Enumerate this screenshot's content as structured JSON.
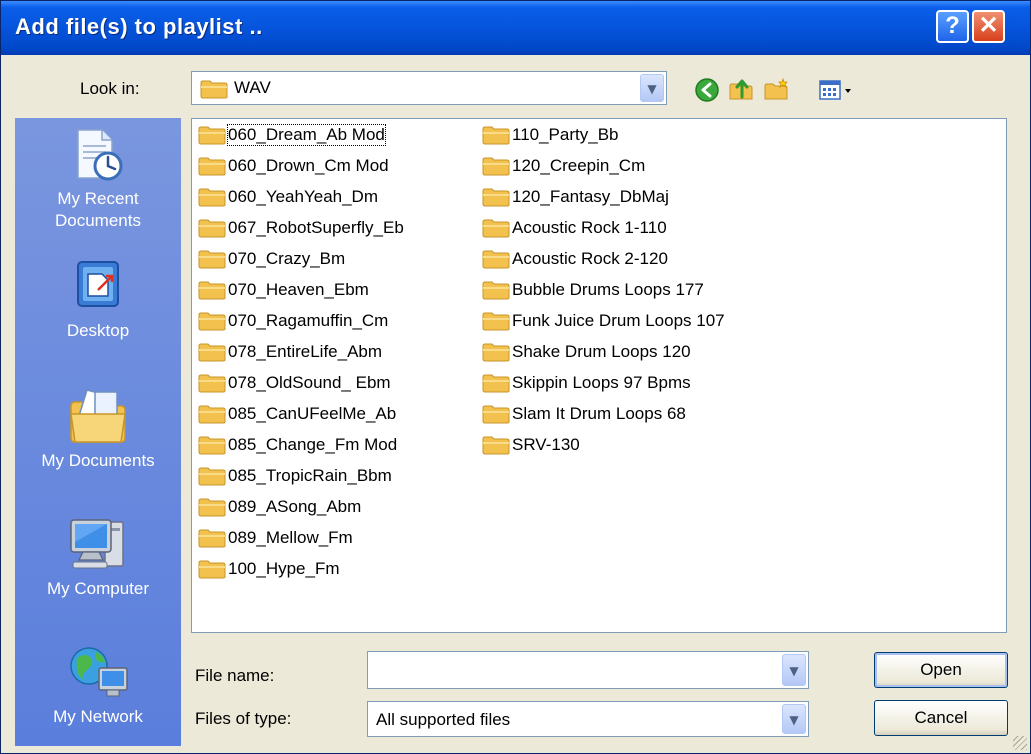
{
  "window": {
    "title": "Add file(s) to playlist ..",
    "help_label": "?",
    "close_label": "✕"
  },
  "toolbar": {
    "look_in_label": "Look in:",
    "current_folder": "WAV",
    "icons": [
      "back-icon",
      "up-folder-icon",
      "new-folder-icon",
      "view-menu-icon"
    ]
  },
  "places": [
    {
      "label_lines": [
        "My Recent",
        "Documents"
      ],
      "icon": "recent-documents-icon"
    },
    {
      "label_lines": [
        "Desktop"
      ],
      "icon": "desktop-icon"
    },
    {
      "label_lines": [
        "My Documents"
      ],
      "icon": "my-documents-icon"
    },
    {
      "label_lines": [
        "My Computer"
      ],
      "icon": "my-computer-icon"
    },
    {
      "label_lines": [
        "My Network"
      ],
      "icon": "my-network-icon"
    }
  ],
  "files": {
    "column1": [
      "060_Dream_Ab Mod",
      "060_Drown_Cm Mod",
      "060_YeahYeah_Dm",
      "067_RobotSuperfly_Eb",
      "070_Crazy_Bm",
      "070_Heaven_Ebm",
      "070_Ragamuffin_Cm",
      "078_EntireLife_Abm",
      "078_OldSound_ Ebm",
      "085_CanUFeelMe_Ab",
      "085_Change_Fm Mod",
      "085_TropicRain_Bbm",
      "089_ASong_Abm",
      "089_Mellow_Fm",
      "100_Hype_Fm"
    ],
    "column2": [
      "110_Party_Bb",
      "120_Creepin_Cm",
      "120_Fantasy_DbMaj",
      "Acoustic Rock 1-110",
      "Acoustic Rock 2-120",
      "Bubble Drums Loops 177",
      "Funk Juice Drum Loops 107",
      "Shake Drum Loops 120",
      "Skippin Loops 97 Bpms",
      "Slam It Drum Loops 68",
      "SRV-130"
    ],
    "selected": "060_Dream_Ab Mod"
  },
  "form": {
    "file_name_label": "File name:",
    "file_name_value": "",
    "file_type_label": "Files of type:",
    "file_type_value": "All supported files",
    "open_label": "Open",
    "cancel_label": "Cancel"
  },
  "colors": {
    "title_bar": "#0654dc",
    "places_bar": "#6b8ae0",
    "dialog_bg": "#ece9d8",
    "folder": "#f2c14e"
  }
}
